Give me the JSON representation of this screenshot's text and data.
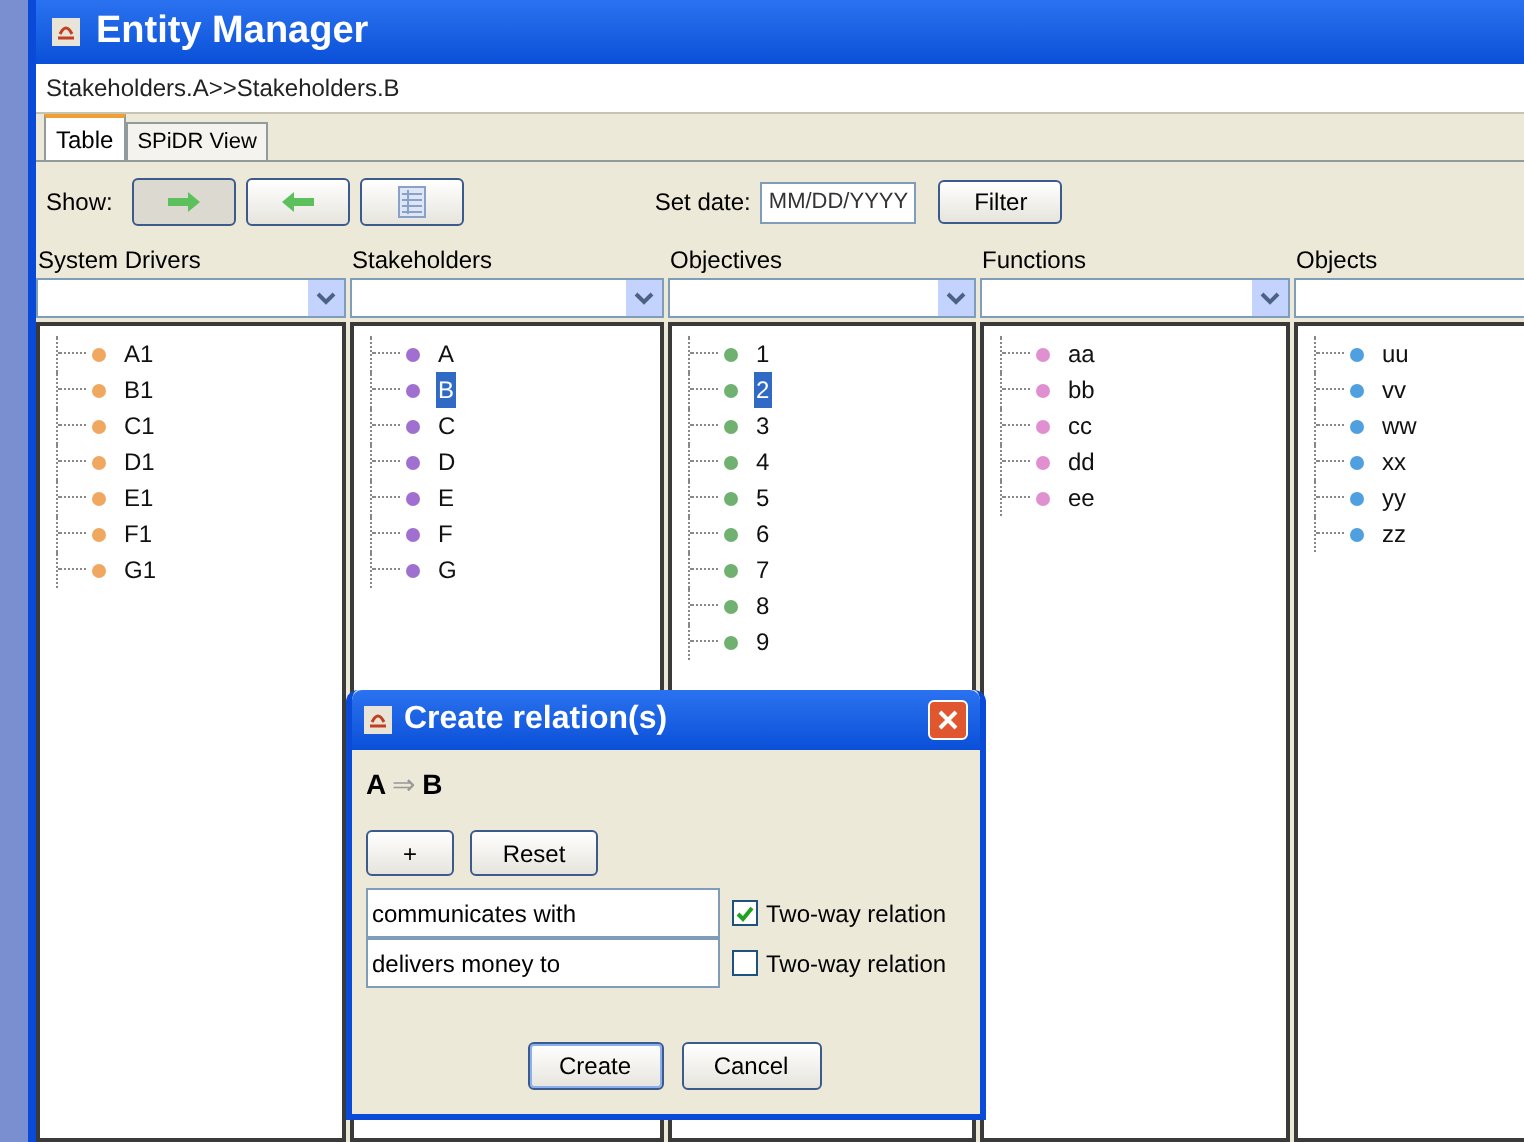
{
  "window": {
    "title": "Entity Manager"
  },
  "path": "Stakeholders.A>>Stakeholders.B",
  "tabs": [
    {
      "label": "Table",
      "selected": true
    },
    {
      "label": "SPiDR View",
      "selected": false
    }
  ],
  "toolbar": {
    "show_label": "Show:",
    "view_buttons": [
      {
        "kind": "forward",
        "selected": true
      },
      {
        "kind": "backward",
        "selected": false
      },
      {
        "kind": "table",
        "selected": false
      }
    ],
    "date_label": "Set date:",
    "date_placeholder": "MM/DD/YYYY",
    "filter_button": "Filter"
  },
  "columns": [
    {
      "header": "System Drivers",
      "color": "#f0a860",
      "items": [
        {
          "label": "A1",
          "selected": false
        },
        {
          "label": "B1",
          "selected": false
        },
        {
          "label": "C1",
          "selected": false
        },
        {
          "label": "D1",
          "selected": false
        },
        {
          "label": "E1",
          "selected": false
        },
        {
          "label": "F1",
          "selected": false
        },
        {
          "label": "G1",
          "selected": false
        }
      ]
    },
    {
      "header": "Stakeholders",
      "color": "#a070d0",
      "items": [
        {
          "label": "A",
          "selected": false
        },
        {
          "label": "B",
          "selected": true
        },
        {
          "label": "C",
          "selected": false
        },
        {
          "label": "D",
          "selected": false
        },
        {
          "label": "E",
          "selected": false
        },
        {
          "label": "F",
          "selected": false
        },
        {
          "label": "G",
          "selected": false
        }
      ]
    },
    {
      "header": "Objectives",
      "color": "#70b070",
      "items": [
        {
          "label": "1",
          "selected": false
        },
        {
          "label": "2",
          "selected": true
        },
        {
          "label": "3",
          "selected": false
        },
        {
          "label": "4",
          "selected": false
        },
        {
          "label": "5",
          "selected": false
        },
        {
          "label": "6",
          "selected": false
        },
        {
          "label": "7",
          "selected": false
        },
        {
          "label": "8",
          "selected": false
        },
        {
          "label": "9",
          "selected": false
        }
      ]
    },
    {
      "header": "Functions",
      "color": "#e090d0",
      "items": [
        {
          "label": "aa",
          "selected": false
        },
        {
          "label": "bb",
          "selected": false
        },
        {
          "label": "cc",
          "selected": false
        },
        {
          "label": "dd",
          "selected": false
        },
        {
          "label": "ee",
          "selected": false
        }
      ]
    },
    {
      "header": "Objects",
      "color": "#50a0e0",
      "items": [
        {
          "label": "uu",
          "selected": false
        },
        {
          "label": "vv",
          "selected": false
        },
        {
          "label": "ww",
          "selected": false
        },
        {
          "label": "xx",
          "selected": false
        },
        {
          "label": "yy",
          "selected": false
        },
        {
          "label": "zz",
          "selected": false
        }
      ]
    }
  ],
  "dialog": {
    "title": "Create relation(s)",
    "from": "A",
    "arrow": "⇒",
    "to": "B",
    "add_button": "+",
    "reset_button": "Reset",
    "relations": [
      {
        "value": "communicates with",
        "checked": true,
        "label": "Two-way relation"
      },
      {
        "value": "delivers money to",
        "checked": false,
        "label": "Two-way relation"
      }
    ],
    "create_button": "Create",
    "cancel_button": "Cancel"
  }
}
